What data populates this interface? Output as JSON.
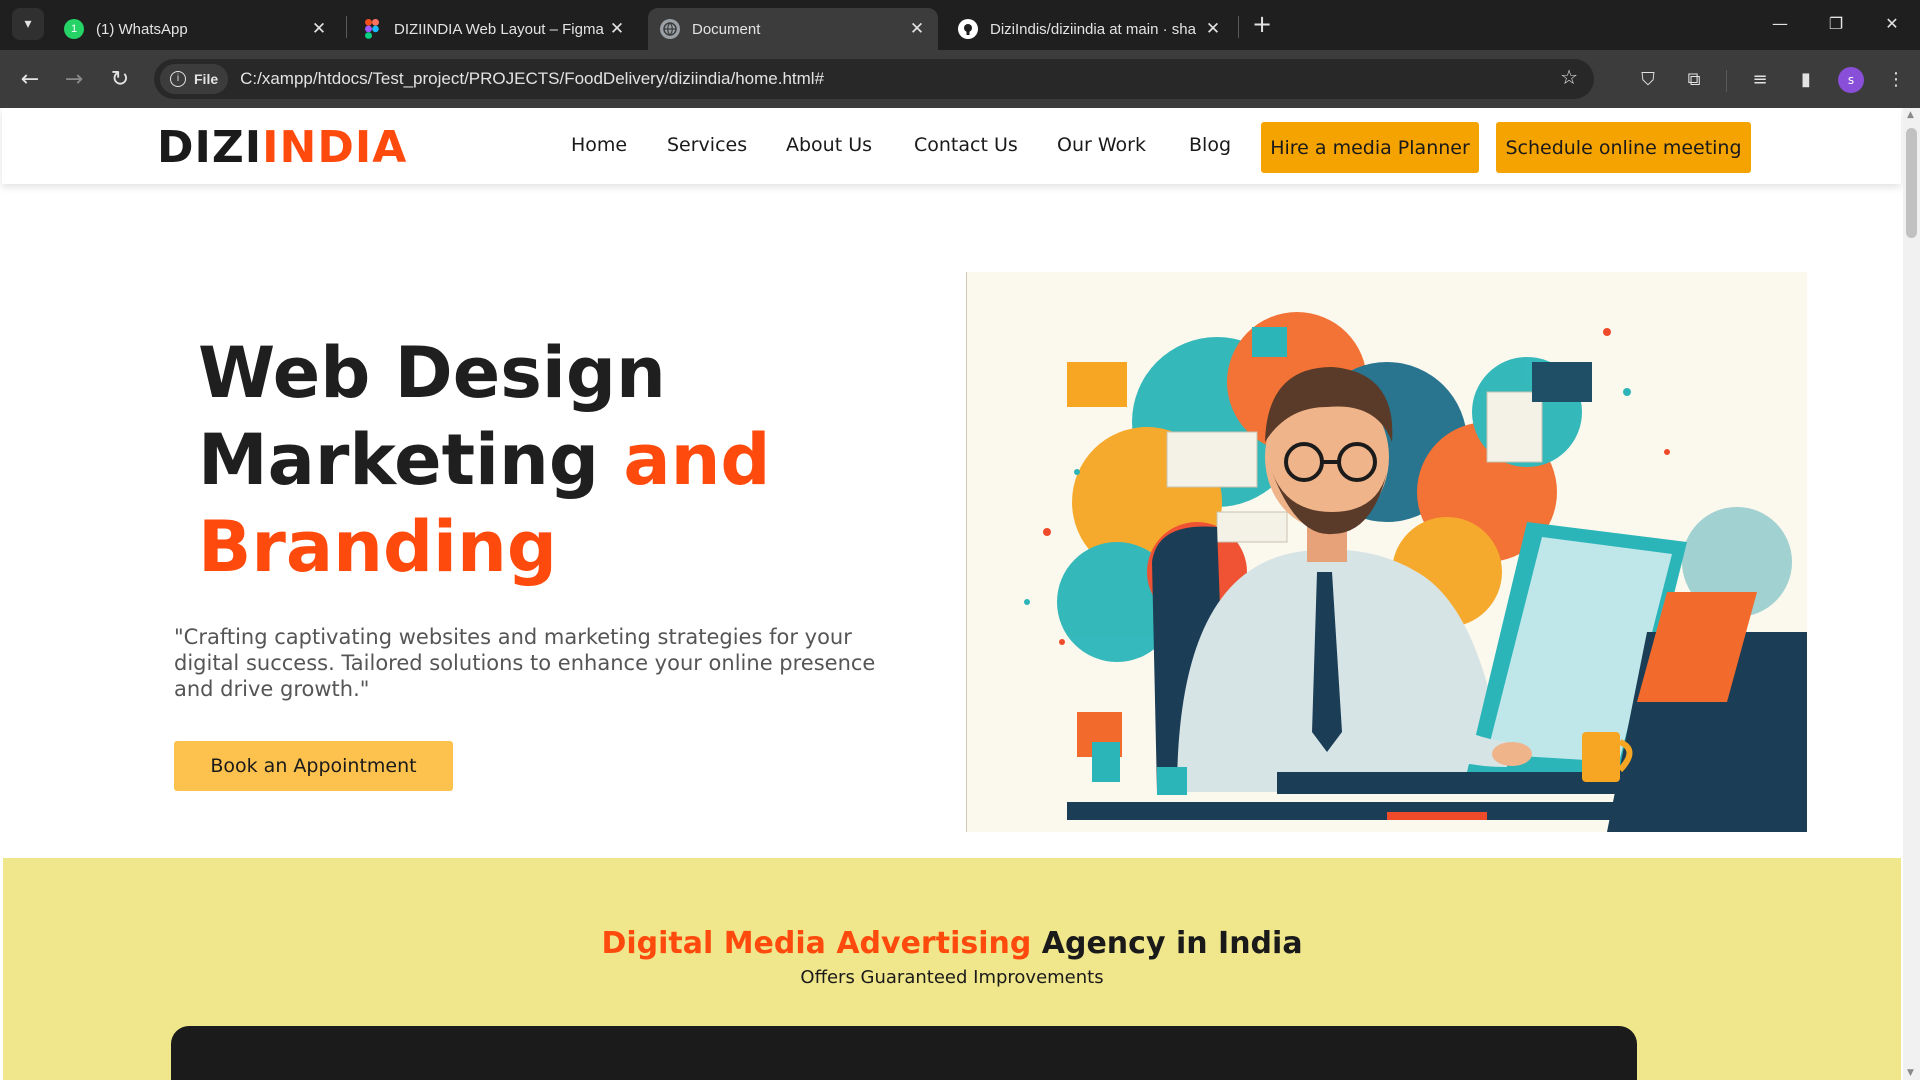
{
  "browser": {
    "tabs": [
      {
        "title": "(1) WhatsApp",
        "icon": "whatsapp-icon",
        "color": "#25d366",
        "badge": "1"
      },
      {
        "title": "DIZIINDIA Web Layout – Figma",
        "icon": "figma-icon",
        "color": "#f24e1e"
      },
      {
        "title": "Document",
        "icon": "globe-icon",
        "color": "#9aa0a6"
      },
      {
        "title": "DiziIndis/diziindia at main · sha",
        "icon": "github-icon",
        "color": "#ffffff"
      }
    ],
    "url_chip": "File",
    "url": "C:/xampp/htdocs/Test_project/PROJECTS/FoodDelivery/diziindia/home.html#",
    "profile_initial": "s"
  },
  "site": {
    "logo_part1": "DIZI",
    "logo_part2": "INDIA",
    "nav": [
      "Home",
      "Services",
      "About Us",
      "Contact Us",
      "Our Work",
      "Blog"
    ],
    "cta_primary": "Hire a media Planner",
    "cta_secondary": "Schedule online meeting",
    "hero": {
      "line1": "Web Design",
      "line2a": "Marketing ",
      "line2b": "and",
      "line3": "Branding",
      "subtitle": "\"Crafting captivating websites and marketing strategies for your digital success. Tailored solutions to enhance your online presence and drive growth.\"",
      "button": "Book an Appointment"
    },
    "band": {
      "title_highlight": "Digital Media Advertising",
      "title_rest": " Agency in India",
      "subtitle": "Offers Guaranteed Improvements"
    }
  },
  "colors": {
    "accent": "#ff4a0d",
    "cta": "#f5a300",
    "book_button": "#fdc24e",
    "band": "#f0e68c"
  }
}
